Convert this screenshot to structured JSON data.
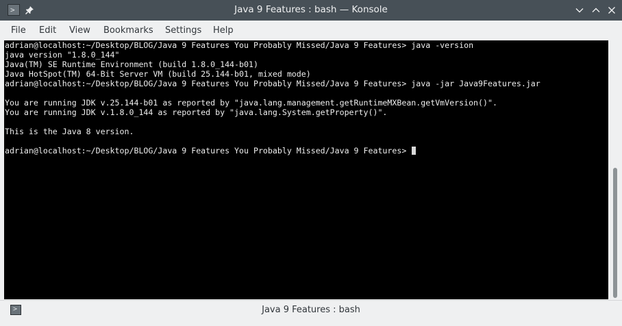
{
  "window": {
    "title": "Java 9 Features : bash — Konsole",
    "app_icon_glyph": ">",
    "buttons": {
      "minimize": "⌄",
      "maximize": "⌃",
      "close": "⨯"
    }
  },
  "menu": {
    "items": [
      "File",
      "Edit",
      "View",
      "Bookmarks",
      "Settings",
      "Help"
    ]
  },
  "terminal": {
    "background": "#000000",
    "foreground": "#eeeeee",
    "lines": [
      "adrian@localhost:~/Desktop/BLOG/Java 9 Features You Probably Missed/Java 9 Features> java -version",
      "java version \"1.8.0_144\"",
      "Java(TM) SE Runtime Environment (build 1.8.0_144-b01)",
      "Java HotSpot(TM) 64-Bit Server VM (build 25.144-b01, mixed mode)",
      "adrian@localhost:~/Desktop/BLOG/Java 9 Features You Probably Missed/Java 9 Features> java -jar Java9Features.jar",
      "",
      "You are running JDK v.25.144-b01 as reported by \"java.lang.management.getRuntimeMXBean.getVmVersion()\".",
      "You are running JDK v.1.8.0_144 as reported by \"java.lang.System.getProperty()\".",
      "",
      "This is the Java 8 version.",
      "",
      "adrian@localhost:~/Desktop/BLOG/Java 9 Features You Probably Missed/Java 9 Features> "
    ]
  },
  "tabs": [
    {
      "label": "Java 9 Features : bash",
      "icon_glyph": ">"
    }
  ]
}
